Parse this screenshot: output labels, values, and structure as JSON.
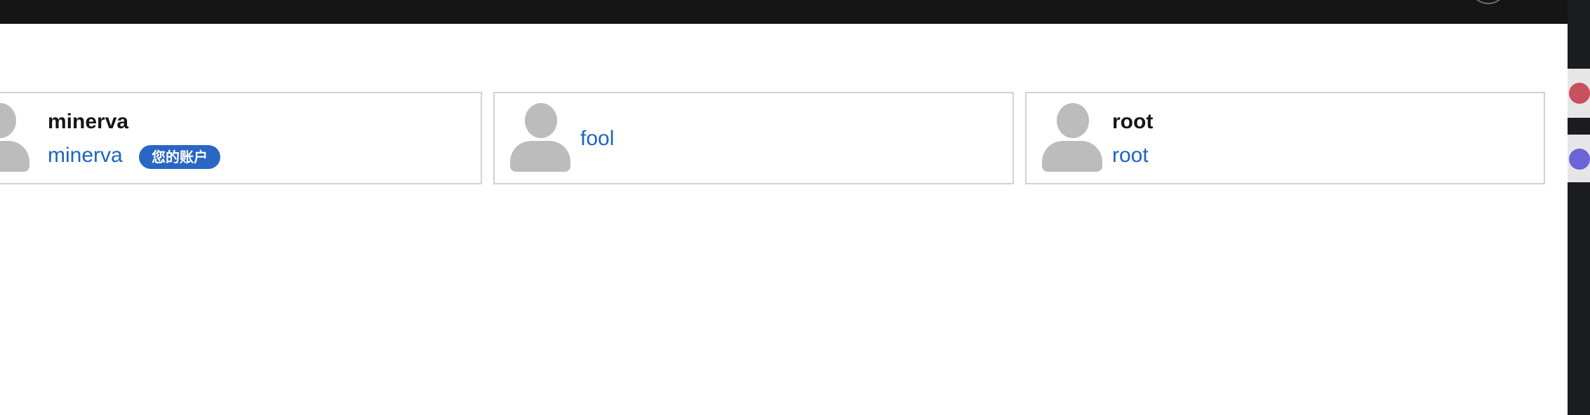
{
  "colors": {
    "topbar": "#151515",
    "link": "#1e63c4",
    "badge": "#2a67c4",
    "avatar_placeholder": "#bcbcbc",
    "card_border": "#d2d2d2"
  },
  "users": [
    {
      "name": "minerva",
      "username": "minerva",
      "badge": "您的账户",
      "icon": "user-avatar-placeholder-icon"
    },
    {
      "name": "",
      "username": "fool",
      "badge": "",
      "icon": "user-avatar-placeholder-icon"
    },
    {
      "name": "root",
      "username": "root",
      "badge": "",
      "icon": "user-avatar-placeholder-icon"
    }
  ]
}
